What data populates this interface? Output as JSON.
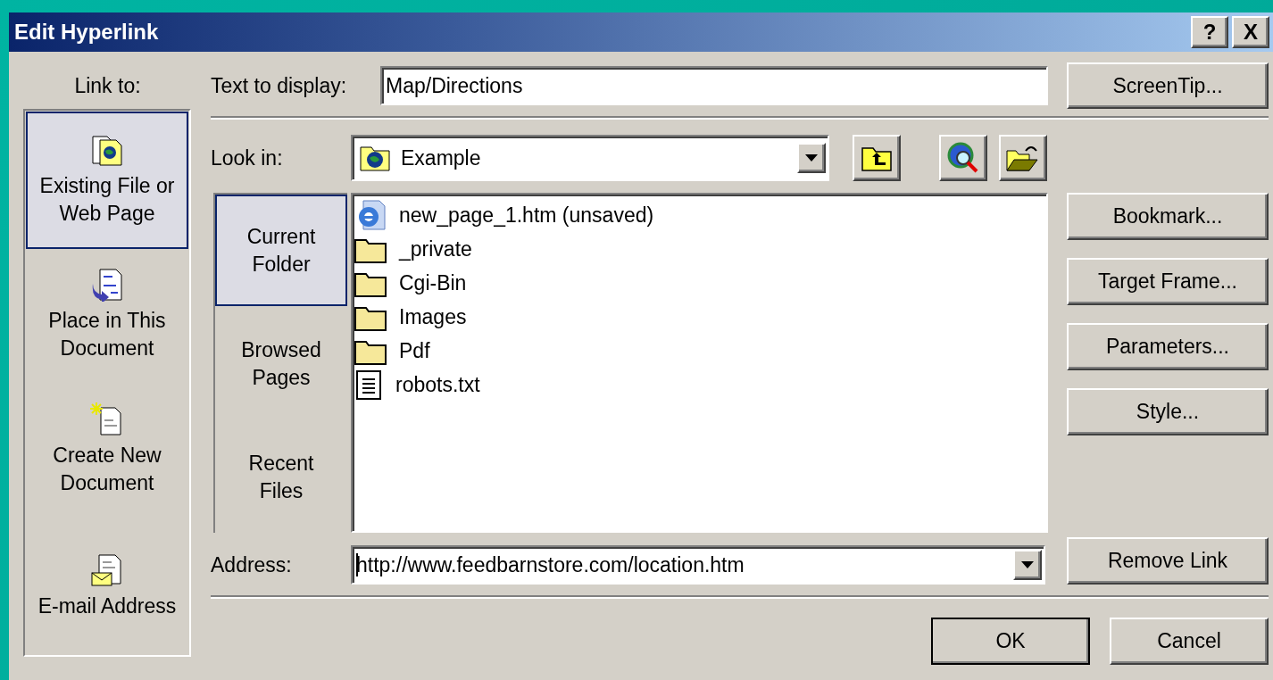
{
  "window": {
    "title": "Edit Hyperlink",
    "help_button": "?",
    "close_button": "X"
  },
  "link_to": {
    "label": "Link to:",
    "items": [
      {
        "label": "Existing File or\nWeb Page",
        "kind": "file",
        "selected": true
      },
      {
        "label": "Place in This\nDocument",
        "kind": "place",
        "selected": false
      },
      {
        "label": "Create New\nDocument",
        "kind": "new",
        "selected": false
      },
      {
        "label": "E-mail Address",
        "kind": "mail",
        "selected": false
      }
    ]
  },
  "text_to_display": {
    "label": "Text to display:",
    "value": "Map/Directions"
  },
  "look_in": {
    "label": "Look in:",
    "value": "Example"
  },
  "places": [
    {
      "label": "Current\nFolder",
      "selected": true
    },
    {
      "label": "Browsed\nPages",
      "selected": false
    },
    {
      "label": "Recent\nFiles",
      "selected": false
    }
  ],
  "files": [
    {
      "name": "new_page_1.htm (unsaved)",
      "kind": "web"
    },
    {
      "name": "_private",
      "kind": "folder"
    },
    {
      "name": "Cgi-Bin",
      "kind": "folder"
    },
    {
      "name": "Images",
      "kind": "folder"
    },
    {
      "name": "Pdf",
      "kind": "folder"
    },
    {
      "name": "robots.txt",
      "kind": "text"
    }
  ],
  "address": {
    "label": "Address:",
    "value": "http://www.feedbarnstore.com/location.htm"
  },
  "screentip_button": "ScreenTip...",
  "side_buttons": [
    "Bookmark...",
    "Target Frame...",
    "Parameters...",
    "Style..."
  ],
  "remove_link_button": "Remove Link",
  "ok_button": "OK",
  "cancel_button": "Cancel"
}
